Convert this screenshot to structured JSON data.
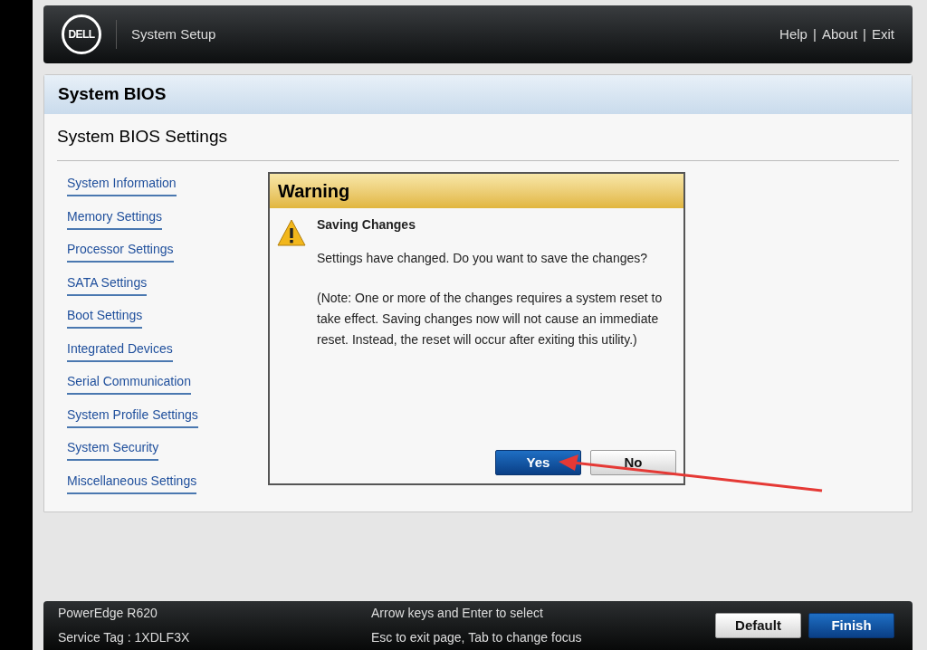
{
  "header": {
    "logo": "DELL",
    "title": "System Setup",
    "links": [
      "Help",
      "About",
      "Exit"
    ],
    "separator": "|"
  },
  "page": {
    "title": "System BIOS",
    "subtitle": "System BIOS Settings"
  },
  "menu": [
    {
      "label": "System Information"
    },
    {
      "label": "Memory Settings"
    },
    {
      "label": "Processor Settings"
    },
    {
      "label": "SATA Settings"
    },
    {
      "label": "Boot Settings"
    },
    {
      "label": "Integrated Devices"
    },
    {
      "label": "Serial Communication"
    },
    {
      "label": "System Profile Settings"
    },
    {
      "label": "System Security"
    },
    {
      "label": "Miscellaneous Settings"
    }
  ],
  "dialog": {
    "title": "Warning",
    "heading": "Saving Changes",
    "message": "Settings have changed. Do you want to save the changes?",
    "note": "(Note: One or more of the changes requires a system reset to take effect. Saving changes now will not cause an immediate reset. Instead, the reset will occur after exiting this utility.)",
    "buttons": [
      {
        "label": "Yes",
        "primary": true
      },
      {
        "label": "No",
        "primary": false
      }
    ]
  },
  "footer": {
    "model": "PowerEdge R620",
    "service_tag": "Service Tag : 1XDLF3X",
    "hints": [
      "Arrow keys and Enter to select",
      "Esc to exit page, Tab to change focus"
    ],
    "buttons": [
      {
        "label": "Default",
        "primary": false
      },
      {
        "label": "Finish",
        "primary": true
      }
    ]
  }
}
